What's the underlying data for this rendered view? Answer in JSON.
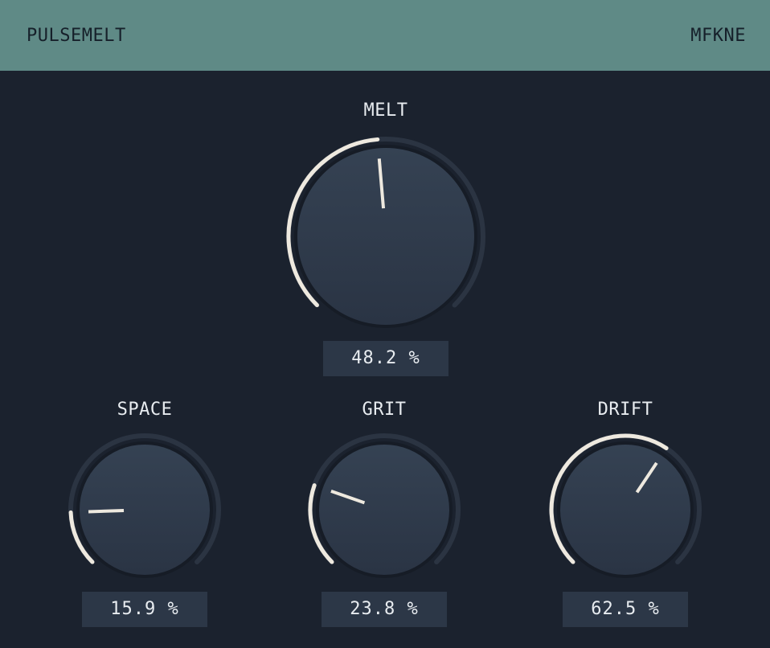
{
  "header": {
    "title": "PULSEMELT",
    "vendor": "MFKNE"
  },
  "colors": {
    "header_bg": "#5f8a86",
    "panel_bg": "#1b222e",
    "track": "#2b3442",
    "arc": "#eee9df",
    "knob_top": "#354253",
    "knob_bottom": "#2a3444",
    "value_box": "#2c3747",
    "text": "#e8ecf0"
  },
  "knobs": {
    "melt": {
      "label": "MELT",
      "value": 0.482,
      "display": "48.2 %"
    },
    "space": {
      "label": "SPACE",
      "value": 0.159,
      "display": "15.9 %"
    },
    "grit": {
      "label": "GRIT",
      "value": 0.238,
      "display": "23.8 %"
    },
    "drift": {
      "label": "DRIFT",
      "value": 0.625,
      "display": "62.5 %"
    }
  }
}
